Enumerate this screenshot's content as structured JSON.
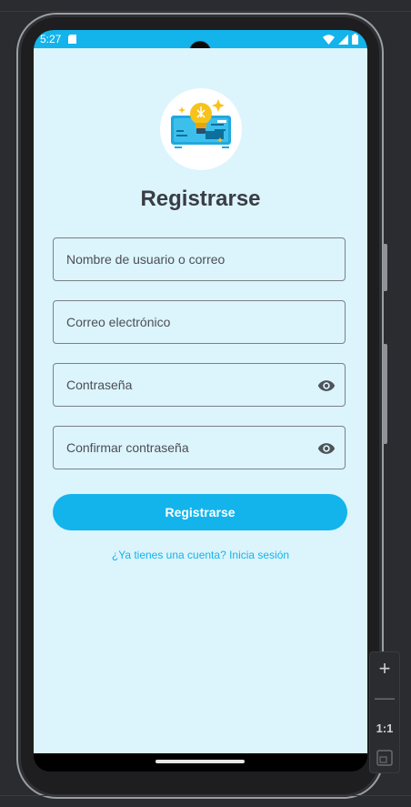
{
  "status_bar": {
    "time": "5:27"
  },
  "form": {
    "title": "Registrarse",
    "username_placeholder": "Nombre de usuario o correo",
    "email_placeholder": "Correo electrónico",
    "password_placeholder": "Contraseña",
    "confirm_password_placeholder": "Confirmar contraseña",
    "submit_label": "Registrarse",
    "login_link": "¿Ya tienes una cuenta? Inicia sesión"
  },
  "zoom_panel": {
    "zoom_in": "+",
    "zoom_out": "—",
    "actual_size": "1:1"
  },
  "colors": {
    "accent": "#13b4eb",
    "background": "#dcf4fc",
    "title": "#3a3d45"
  }
}
